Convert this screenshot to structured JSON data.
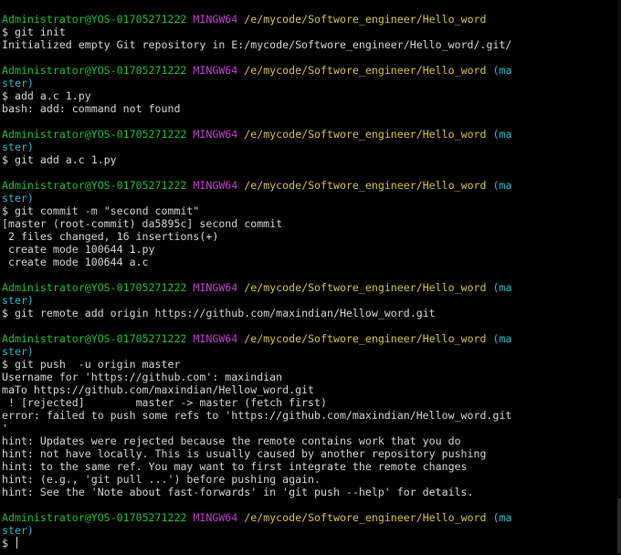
{
  "terminal": {
    "prompt": {
      "user": "Administrator@YOS-01705271222",
      "env": "MINGW64",
      "path": "/e/mycode/Softwore_engineer/Hello_word",
      "branch_part1": "(ma",
      "branch_part2": "ster)",
      "symbol": "$ "
    },
    "blocks": [
      {
        "show_branch": false,
        "command": "git init",
        "output": [
          "Initialized empty Git repository in E:/mycode/Softwore_engineer/Hello_word/.git/"
        ]
      },
      {
        "show_branch": true,
        "command": "add a.c 1.py",
        "output": [
          "bash: add: command not found"
        ]
      },
      {
        "show_branch": true,
        "command": "git add a.c 1.py",
        "output": []
      },
      {
        "show_branch": true,
        "command": "git commit -m \"second commit\"",
        "output": [
          "[master (root-commit) da5895c] second commit",
          " 2 files changed, 16 insertions(+)",
          " create mode 100644 1.py",
          " create mode 100644 a.c"
        ]
      },
      {
        "show_branch": true,
        "command": "git remote add origin https://github.com/maxindian/Hellow_word.git",
        "output": []
      },
      {
        "show_branch": true,
        "command": "git push  -u origin master",
        "output": [
          "Username for 'https://github.com': maxindian",
          "maTo https://github.com/maxindian/Hellow_word.git",
          " ! [rejected]        master -> master (fetch first)",
          "error: failed to push some refs to 'https://github.com/maxindian/Hellow_word.git",
          "'",
          "hint: Updates were rejected because the remote contains work that you do",
          "hint: not have locally. This is usually caused by another repository pushing",
          "hint: to the same ref. You may want to first integrate the remote changes",
          "hint: (e.g., 'git pull ...') before pushing again.",
          "hint: See the 'Note about fast-forwards' in 'git push --help' for details."
        ]
      },
      {
        "show_branch": true,
        "command": "",
        "output": [],
        "cursor": true
      }
    ]
  }
}
